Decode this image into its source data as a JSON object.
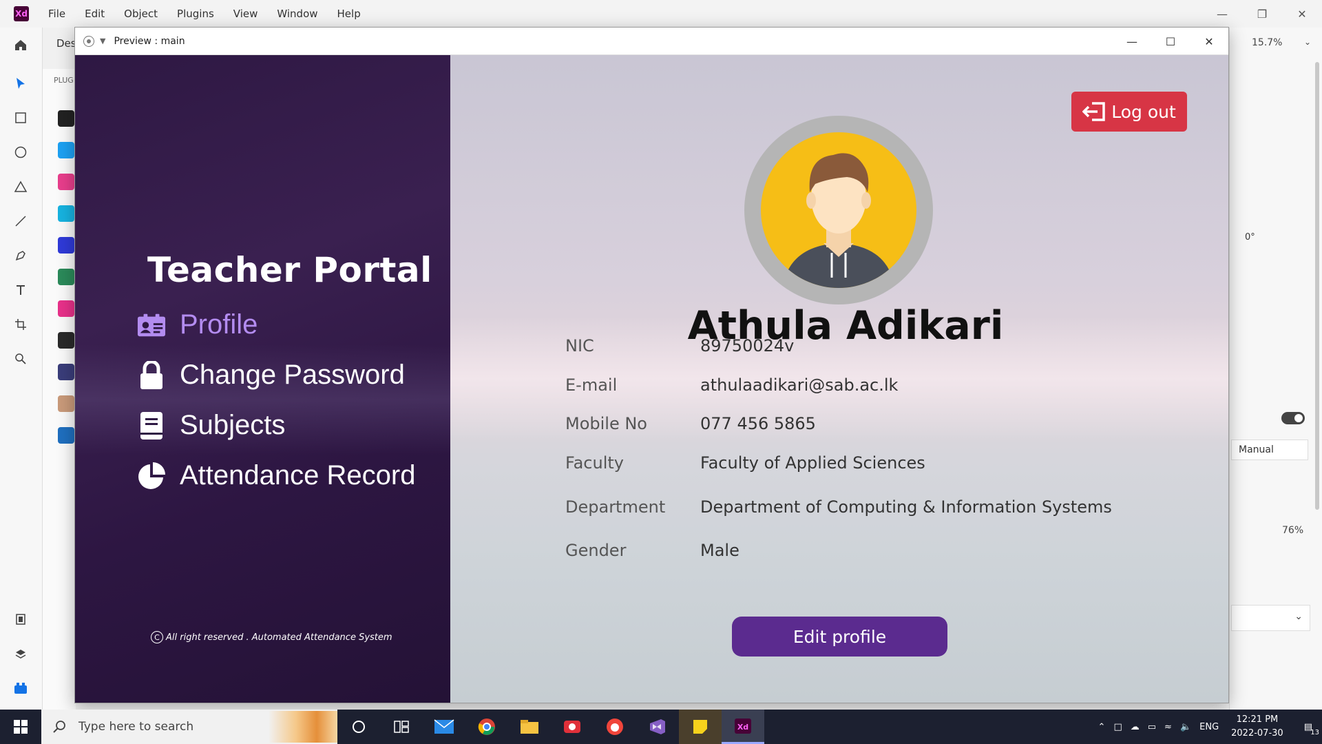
{
  "host": {
    "app_logo": "Xd",
    "menu": [
      "File",
      "Edit",
      "Object",
      "Plugins",
      "View",
      "Window",
      "Help"
    ],
    "tab_label": "Des",
    "plugins_title": "PLUG",
    "zoom": "15.7%",
    "rotation": "0°",
    "mode": "Manual",
    "opacity": "76%"
  },
  "preview": {
    "title": "Preview : main"
  },
  "portal": {
    "title": "Teacher Portal",
    "nav": [
      {
        "label": "Profile",
        "icon": "id-card-icon",
        "active": true
      },
      {
        "label": "Change Password",
        "icon": "lock-icon",
        "active": false
      },
      {
        "label": "Subjects",
        "icon": "book-icon",
        "active": false
      },
      {
        "label": "Attendance Record",
        "icon": "pie-chart-icon",
        "active": false
      }
    ],
    "copyright_symbol": "C",
    "copyright": "All right reserved . Automated Attendance System"
  },
  "profile": {
    "logout_label": "Log out",
    "name": "Athula Adikari",
    "fields": [
      {
        "label": "NIC",
        "value": "89750024v"
      },
      {
        "label": "E-mail",
        "value": "athulaadikari@sab.ac.lk"
      },
      {
        "label": "Mobile No",
        "value": "077 456 5865"
      },
      {
        "label": "Faculty",
        "value": "Faculty of Applied Sciences"
      },
      {
        "label": "Department",
        "value": "Department of Computing & Information Systems"
      },
      {
        "label": "Gender",
        "value": "Male"
      }
    ],
    "edit_label": "Edit profile"
  },
  "taskbar": {
    "search_placeholder": "Type here to search",
    "language": "ENG",
    "time": "12:21 PM",
    "date": "2022-07-30",
    "notification_count": "13"
  },
  "colors": {
    "sidebar": "#2e1843",
    "active_nav": "#b38cf0",
    "logout": "#d73545",
    "edit": "#5b2b8f",
    "avatar_bg": "#f6be16"
  }
}
